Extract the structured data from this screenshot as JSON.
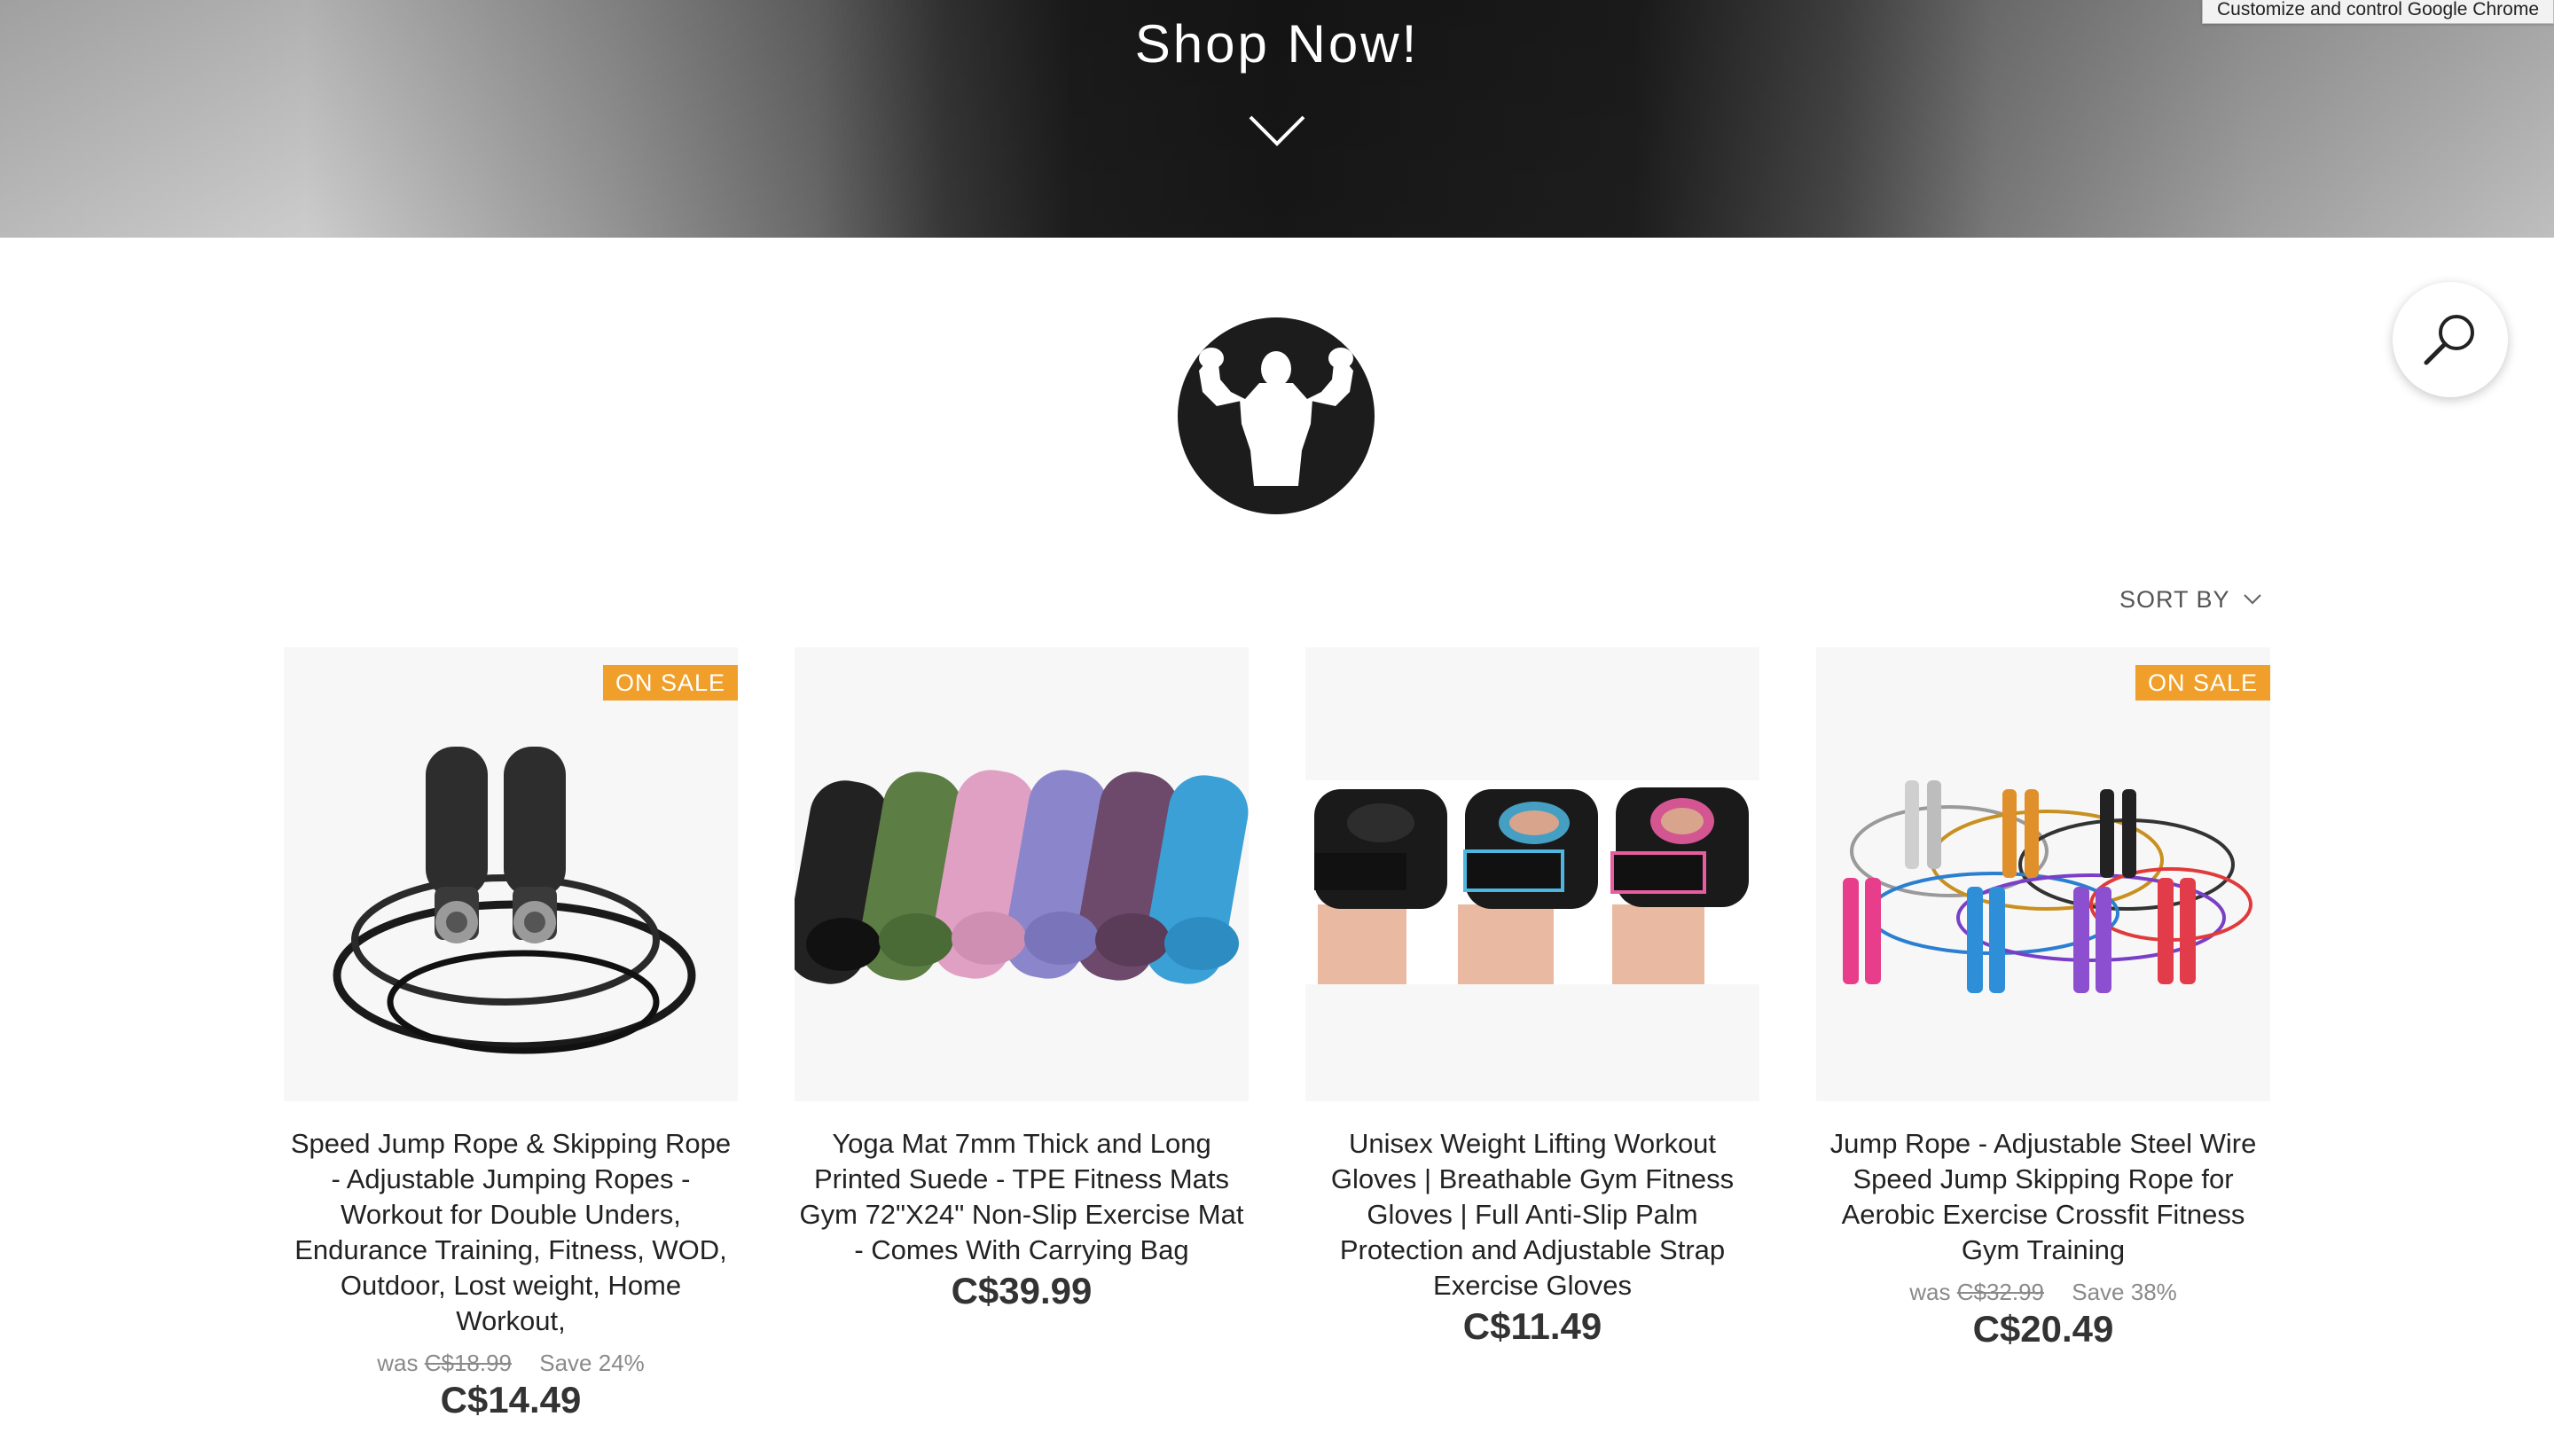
{
  "hero": {
    "title": "Shop Now!"
  },
  "chrome_tooltip": "Customize and control Google Chrome",
  "sort": {
    "label": "SORT BY"
  },
  "products": [
    {
      "badge": "ON SALE",
      "title": "Speed Jump Rope & Skipping Rope - Adjustable Jumping Ropes - Workout for Double Unders, Endurance Training, Fitness, WOD, Outdoor, Lost weight, Home Workout,",
      "was_label": "was",
      "was_price": "C$18.99",
      "save": "Save 24%",
      "price": "C$14.49"
    },
    {
      "title": "Yoga Mat 7mm Thick and Long Printed Suede - TPE Fitness Mats Gym 72\"X24\" Non-Slip Exercise Mat - Comes With Carrying Bag",
      "price": "C$39.99"
    },
    {
      "title": "Unisex Weight Lifting Workout Gloves | Breathable Gym Fitness Gloves | Full Anti-Slip Palm Protection and Adjustable Strap Exercise Gloves",
      "price": "C$11.49"
    },
    {
      "badge": "ON SALE",
      "title": "Jump Rope - Adjustable Steel Wire Speed Jump Skipping Rope for Aerobic Exercise Crossfit Fitness Gym Training",
      "was_label": "was",
      "was_price": "C$32.99",
      "save": "Save 38%",
      "price": "C$20.49"
    }
  ],
  "colors": {
    "badge": "#f0a02a",
    "hero_dark": "#181818"
  }
}
